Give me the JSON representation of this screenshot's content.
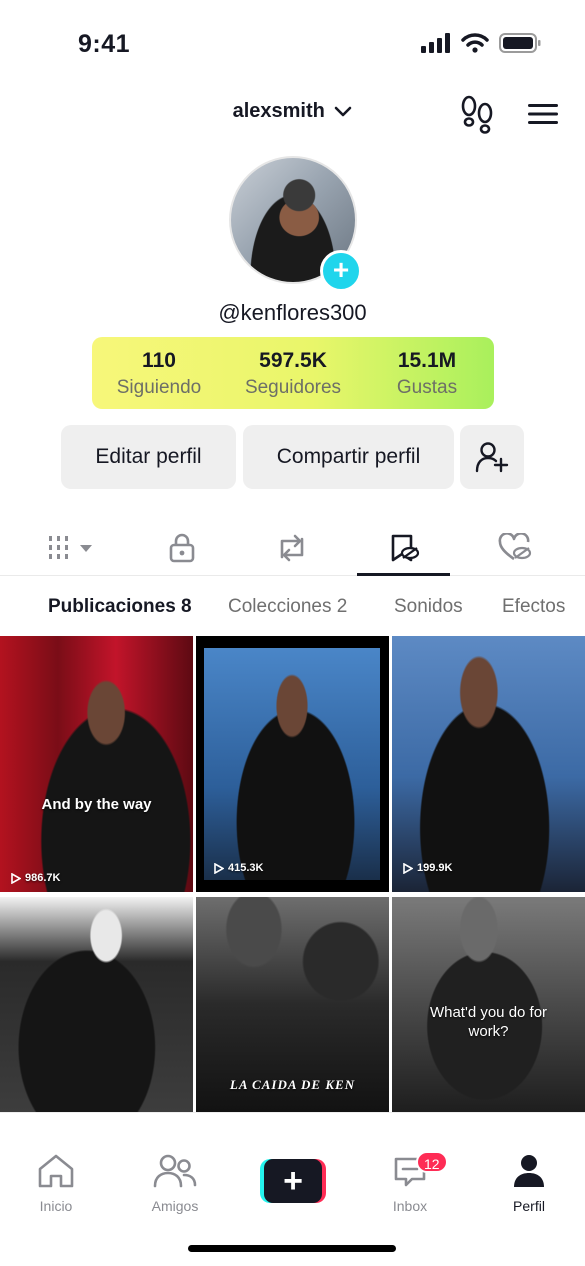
{
  "status_bar": {
    "time": "9:41"
  },
  "header": {
    "username": "alexsmith"
  },
  "profile": {
    "handle": "@kenflores300",
    "stats": [
      {
        "value": "110",
        "label": "Siguiendo"
      },
      {
        "value": "597.5K",
        "label": "Seguidores"
      },
      {
        "value": "15.1M",
        "label": "Gustas"
      }
    ]
  },
  "actions": {
    "edit": "Editar perfil",
    "share": "Compartir perfil"
  },
  "tabs": [
    {
      "label": "Publicaciones 8",
      "active": true
    },
    {
      "label": "Colecciones 2",
      "active": false
    },
    {
      "label": "Sonidos",
      "active": false
    },
    {
      "label": "Efectos",
      "active": false
    }
  ],
  "videos": [
    {
      "caption": "And by the way",
      "views": "986.7K"
    },
    {
      "caption": "",
      "views": "415.3K"
    },
    {
      "caption": "",
      "views": "199.9K"
    },
    {
      "caption": "",
      "views": ""
    },
    {
      "caption": "La Caida de Ken",
      "views": ""
    },
    {
      "caption": "What'd you do for work?",
      "views": ""
    }
  ],
  "nav": [
    {
      "label": "Inicio"
    },
    {
      "label": "Amigos"
    },
    {
      "label": "Inbox",
      "badge": "12"
    },
    {
      "label": "Perfil"
    }
  ],
  "colors": {
    "accent": "#20d5ec",
    "badge": "#fe2c55",
    "create_left": "#25f4ee"
  }
}
